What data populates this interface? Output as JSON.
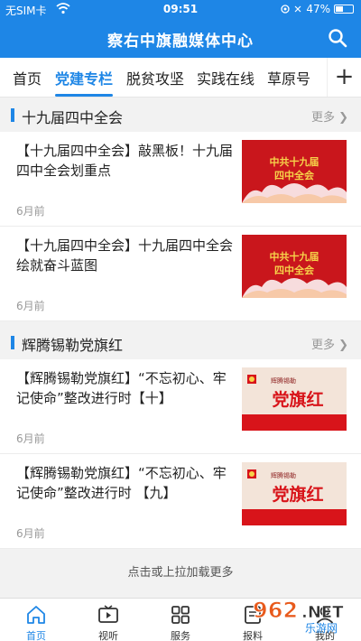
{
  "status_bar": {
    "carrier": "无SIM卡",
    "time": "09:51",
    "battery": "47%",
    "battery_level": 0.47
  },
  "app": {
    "title": "察右中旗融媒体中心"
  },
  "tabs": [
    {
      "label": "首页"
    },
    {
      "label": "党建专栏",
      "active": true
    },
    {
      "label": "脱贫攻坚"
    },
    {
      "label": "实践在线"
    },
    {
      "label": "草原号"
    }
  ],
  "tab_add": "+",
  "sections": [
    {
      "title": "十九届四中全会",
      "more": "更多",
      "items": [
        {
          "headline": "【十九届四中全会】敲黑板！十九届四中全会划重点",
          "time": "6月前",
          "image_text": "中共十九届四中全会"
        },
        {
          "headline": "【十九届四中全会】十九届四中全会绘就奋斗蓝图",
          "time": "6月前",
          "image_text": "中共十九届四中全会"
        }
      ]
    },
    {
      "title": "辉腾锡勒党旗红",
      "more": "更多",
      "items": [
        {
          "headline": "【辉腾锡勒党旗红】“不忘初心、牢记使命”整改进行时【十】",
          "time": "6月前",
          "image_text": "党旗红",
          "image_small": "辉腾锡勒"
        },
        {
          "headline": "【辉腾锡勒党旗红】“不忘初心、牢记使命”整改进行时 【九】",
          "time": "6月前",
          "image_text": "党旗红",
          "image_small": "辉腾锡勒"
        }
      ]
    }
  ],
  "load_more": "点击或上拉加载更多",
  "bottom_nav": [
    {
      "label": "首页",
      "icon": "home-icon",
      "active": true
    },
    {
      "label": "视听",
      "icon": "tv-icon"
    },
    {
      "label": "服务",
      "icon": "grid-icon"
    },
    {
      "label": "报料",
      "icon": "report-icon"
    },
    {
      "label": "我的",
      "icon": "user-icon"
    }
  ],
  "watermark": {
    "brand": "962.NET",
    "sub": "乐游网"
  },
  "colors": {
    "accent": "#1e86e6",
    "party_red": "#d8141a",
    "gold": "#f6d34a"
  }
}
